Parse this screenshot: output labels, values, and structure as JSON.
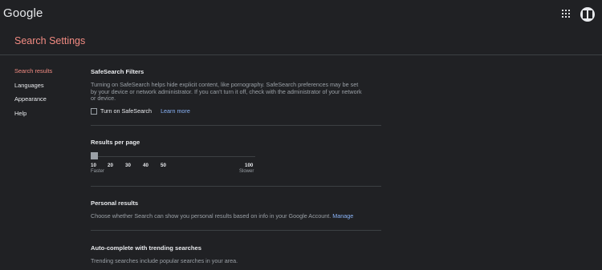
{
  "header": {
    "logo": "Google",
    "apps_icon": "apps-grid-icon",
    "avatar_icon": "account-avatar-icon"
  },
  "page": {
    "title": "Search Settings"
  },
  "sidebar": {
    "items": [
      {
        "label": "Search results",
        "active": true
      },
      {
        "label": "Languages",
        "active": false
      },
      {
        "label": "Appearance",
        "active": false
      },
      {
        "label": "Help",
        "active": false
      }
    ]
  },
  "safesearch": {
    "title": "SafeSearch Filters",
    "desc_line1": "Turning on SafeSearch helps hide explicit content, like pornography. SafeSearch preferences may be set",
    "desc_line2": "by your device or network administrator. If you can't turn it off, check with the administrator of your network",
    "desc_line3": "or device.",
    "checkbox_label": "Turn on SafeSearch",
    "checked": false,
    "learn_more": "Learn more"
  },
  "results_per_page": {
    "title": "Results per page",
    "ticks": [
      "10",
      "20",
      "30",
      "40",
      "50",
      "100"
    ],
    "min_label": "Faster",
    "max_label": "Slower",
    "selected": "10"
  },
  "personal_results": {
    "title": "Personal results",
    "desc": "Choose whether Search can show you personal results based on info in your Google Account.",
    "manage": "Manage"
  },
  "autocomplete": {
    "title": "Auto-complete with trending searches",
    "desc": "Trending searches include popular searches in your area."
  },
  "colors": {
    "background": "#202124",
    "accent": "#f28b82",
    "link": "#8ab4f8",
    "text": "#e8eaed",
    "muted": "#9aa0a6"
  }
}
